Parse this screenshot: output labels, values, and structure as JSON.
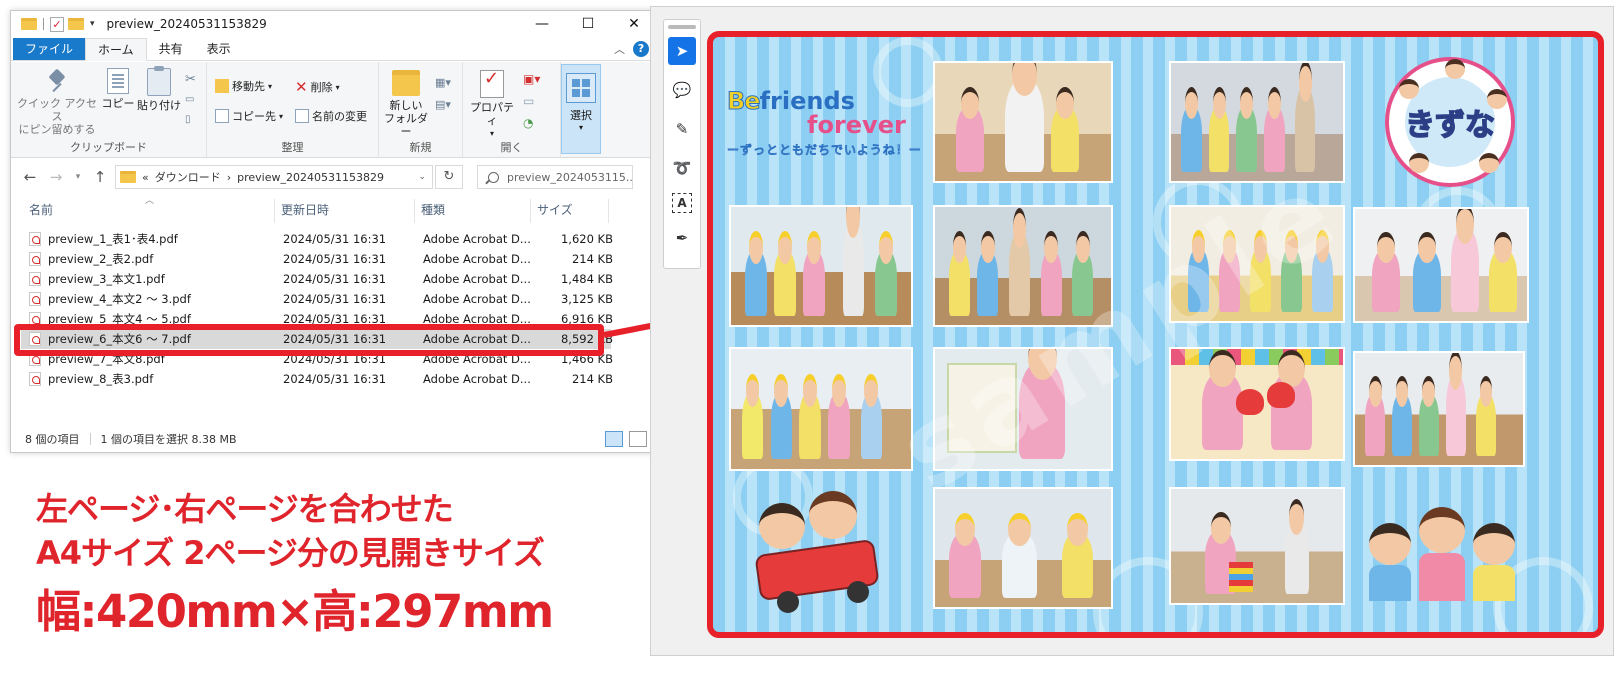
{
  "explorer": {
    "title": "preview_20240531153829",
    "ribbon_tabs": [
      "ファイル",
      "ホーム",
      "共有",
      "表示"
    ],
    "ribbon": {
      "pin_label_line1": "クイック アクセス",
      "pin_label_line2": "にピン留めする",
      "copy_label": "コピー",
      "paste_label": "貼り付け",
      "clipboard_group": "クリップボード",
      "move_to": "移動先",
      "copy_to": "コピー先",
      "delete": "削除",
      "rename": "名前の変更",
      "organize_group": "整理",
      "new_folder_line1": "新しい",
      "new_folder_line2": "フォルダー",
      "new_group": "新規",
      "properties": "プロパティ",
      "open_group": "開く",
      "select": "選択"
    },
    "address": {
      "crumb_prefix": "«",
      "crumb_1": "ダウンロード",
      "crumb_sep": "›",
      "crumb_2": "preview_20240531153829",
      "search_placeholder": "preview_2024053115..."
    },
    "columns": [
      "名前",
      "更新日時",
      "種類",
      "サイズ"
    ],
    "files": [
      {
        "name": "preview_1_表1･表4.pdf",
        "date": "2024/05/31 16:31",
        "type": "Adobe Acrobat D...",
        "size": "1,620 KB"
      },
      {
        "name": "preview_2_表2.pdf",
        "date": "2024/05/31 16:31",
        "type": "Adobe Acrobat D...",
        "size": "214 KB"
      },
      {
        "name": "preview_3_本文1.pdf",
        "date": "2024/05/31 16:31",
        "type": "Adobe Acrobat D...",
        "size": "1,484 KB"
      },
      {
        "name": "preview_4_本文2 ～ 3.pdf",
        "date": "2024/05/31 16:31",
        "type": "Adobe Acrobat D...",
        "size": "3,125 KB"
      },
      {
        "name": "preview_5_本文4 ～ 5.pdf",
        "date": "2024/05/31 16:31",
        "type": "Adobe Acrobat D...",
        "size": "6,916 KB"
      },
      {
        "name": "preview_6_本文6 ～ 7.pdf",
        "date": "2024/05/31 16:31",
        "type": "Adobe Acrobat D...",
        "size": "8,592 KB"
      },
      {
        "name": "preview_7_本文8.pdf",
        "date": "2024/05/31 16:31",
        "type": "Adobe Acrobat D...",
        "size": "1,466 KB"
      },
      {
        "name": "preview_8_表3.pdf",
        "date": "2024/05/31 16:31",
        "type": "Adobe Acrobat D...",
        "size": "214 KB"
      }
    ],
    "selected_index": 5,
    "status": {
      "count": "8 個の項目",
      "selection": "1 個の項目を選択  8.38 MB"
    }
  },
  "caption": {
    "line1": "左ページ･右ページを合わせた",
    "line2": "A4サイズ 2ページ分の見開きサイズ",
    "line3": "幅:420mm×高:297mm"
  },
  "album": {
    "logo_line1_a": "Be",
    "logo_line1_b": "friends",
    "logo_line2": "forever",
    "logo_sub": "ーずっとともだちでいようね！ー",
    "badge": "きずな",
    "watermark": "sample"
  },
  "colors": {
    "accent_red": "#e8202a",
    "ribbon_file_tab": "#1979ca",
    "album_stripe_dark": "#8ccff2",
    "album_stripe_light": "#b9e3f8"
  },
  "icons": [
    "folder-icon",
    "checkmark-icon",
    "minimize-icon",
    "maximize-icon",
    "close-icon",
    "help-icon",
    "pin-icon",
    "copy-icon",
    "paste-icon",
    "cut-icon",
    "move-icon",
    "delete-icon",
    "rename-icon",
    "new-folder-icon",
    "properties-icon",
    "pdf-icon",
    "select-icon",
    "back-icon",
    "forward-icon",
    "up-icon",
    "refresh-icon",
    "search-icon",
    "select-tool-icon",
    "comment-icon",
    "highlight-icon",
    "draw-icon",
    "text-select-icon",
    "sign-icon"
  ]
}
